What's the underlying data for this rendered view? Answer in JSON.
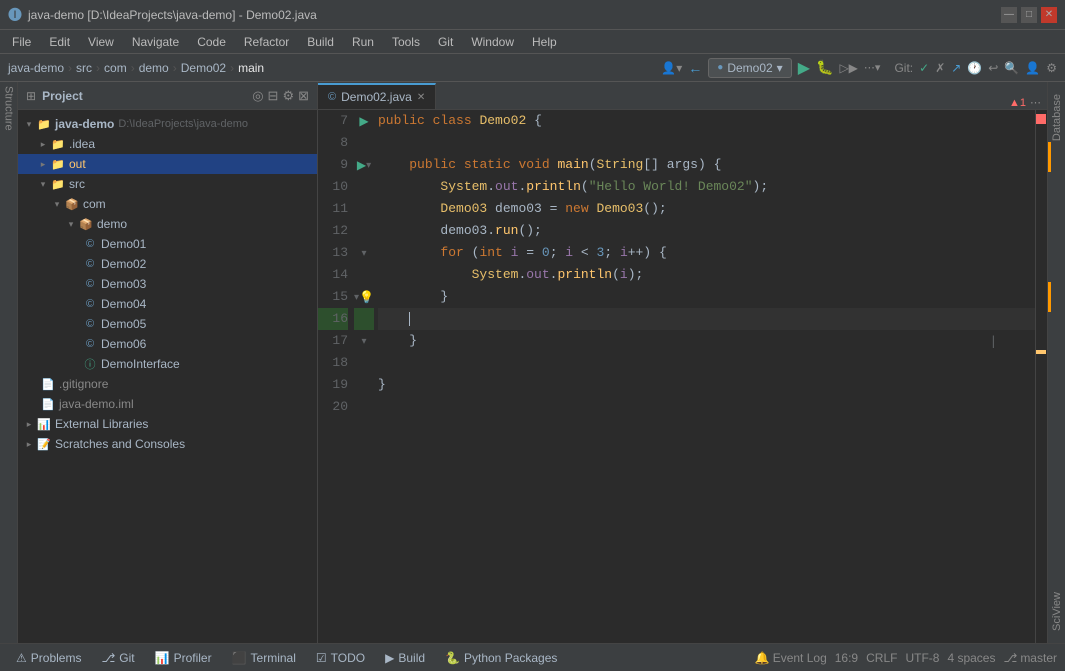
{
  "titlebar": {
    "project": "java-demo",
    "path": "D:\\IdeaProjects\\java-demo",
    "file": "Demo02.java",
    "title": "java-demo [D:\\IdeaProjects\\java-demo] - Demo02.java"
  },
  "menu": {
    "items": [
      "File",
      "Edit",
      "View",
      "Navigate",
      "Code",
      "Refactor",
      "Build",
      "Run",
      "Tools",
      "Git",
      "Window",
      "Help"
    ]
  },
  "breadcrumb": {
    "items": [
      "java-demo",
      "src",
      "com",
      "demo",
      "Demo02",
      "main"
    ]
  },
  "run_config": {
    "label": "Demo02",
    "dropdown": "▾"
  },
  "project": {
    "title": "Project",
    "tree": [
      {
        "id": "java-demo-root",
        "label": "java-demo",
        "sub": "D:\\IdeaProjects\\java-demo",
        "type": "project",
        "depth": 0,
        "expanded": true
      },
      {
        "id": "out",
        "label": ".idea",
        "type": "folder-blue",
        "depth": 1,
        "expanded": false
      },
      {
        "id": "idea",
        "label": "out",
        "type": "folder-yellow",
        "depth": 1,
        "expanded": false,
        "selected": true
      },
      {
        "id": "src",
        "label": "src",
        "type": "folder-src",
        "depth": 1,
        "expanded": true
      },
      {
        "id": "com",
        "label": "com",
        "type": "folder",
        "depth": 2,
        "expanded": true
      },
      {
        "id": "demo",
        "label": "demo",
        "type": "folder",
        "depth": 3,
        "expanded": true
      },
      {
        "id": "Demo01",
        "label": "Demo01",
        "type": "java",
        "depth": 4
      },
      {
        "id": "Demo02",
        "label": "Demo02",
        "type": "java",
        "depth": 4
      },
      {
        "id": "Demo03",
        "label": "Demo03",
        "type": "java",
        "depth": 4
      },
      {
        "id": "Demo04",
        "label": "Demo04",
        "type": "java",
        "depth": 4
      },
      {
        "id": "Demo05",
        "label": "Demo05",
        "type": "java",
        "depth": 4
      },
      {
        "id": "Demo06",
        "label": "Demo06",
        "type": "java",
        "depth": 4
      },
      {
        "id": "DemoInterface",
        "label": "DemoInterface",
        "type": "interface",
        "depth": 4
      },
      {
        "id": "gitignore",
        "label": ".gitignore",
        "type": "file",
        "depth": 1
      },
      {
        "id": "iml",
        "label": "java-demo.iml",
        "type": "iml",
        "depth": 1
      },
      {
        "id": "ext-libs",
        "label": "External Libraries",
        "type": "ext",
        "depth": 0,
        "expanded": false
      },
      {
        "id": "scratches",
        "label": "Scratches and Consoles",
        "type": "scratches",
        "depth": 0,
        "expanded": false
      }
    ]
  },
  "editor": {
    "filename": "Demo02.java",
    "lines": [
      {
        "num": 7,
        "content": "public class Demo02 {",
        "has_run": true,
        "indent": 0
      },
      {
        "num": 8,
        "content": "",
        "indent": 0
      },
      {
        "num": 9,
        "content": "    public static void main(String[] args) {",
        "has_run": true,
        "has_fold": true,
        "indent": 1
      },
      {
        "num": 10,
        "content": "        System.out.println(\"Hello World! Demo02\");",
        "indent": 2
      },
      {
        "num": 11,
        "content": "        Demo03 demo03 = new Demo03();",
        "indent": 2
      },
      {
        "num": 12,
        "content": "        demo03.run();",
        "indent": 2
      },
      {
        "num": 13,
        "content": "        for (int i = 0; i < 3; i++) {",
        "has_fold": true,
        "indent": 2
      },
      {
        "num": 14,
        "content": "            System.out.println(i);",
        "indent": 3
      },
      {
        "num": 15,
        "content": "        }",
        "has_warning": true,
        "indent": 2
      },
      {
        "num": 16,
        "content": "",
        "indent": 0,
        "active": true
      },
      {
        "num": 17,
        "content": "    }",
        "has_fold": true,
        "indent": 1
      },
      {
        "num": 18,
        "content": "",
        "indent": 0
      },
      {
        "num": 19,
        "content": "}",
        "indent": 0
      },
      {
        "num": 20,
        "content": "",
        "indent": 0
      }
    ]
  },
  "bottom_tabs": [
    {
      "label": "Problems",
      "icon": "⚠"
    },
    {
      "label": "Git",
      "icon": ""
    },
    {
      "label": "Profiler",
      "icon": ""
    },
    {
      "label": "Terminal",
      "icon": ""
    },
    {
      "label": "TODO",
      "icon": ""
    },
    {
      "label": "Build",
      "icon": "▶"
    },
    {
      "label": "Python Packages",
      "icon": ""
    }
  ],
  "status_bar": {
    "position": "16:9",
    "line_endings": "CRLF",
    "encoding": "UTF-8",
    "indent": "4 spaces",
    "branch": "master",
    "notifications": "Event Log"
  },
  "right_side_labels": [
    "Database",
    "SciView"
  ],
  "alerts": {
    "errors": "▲1"
  }
}
